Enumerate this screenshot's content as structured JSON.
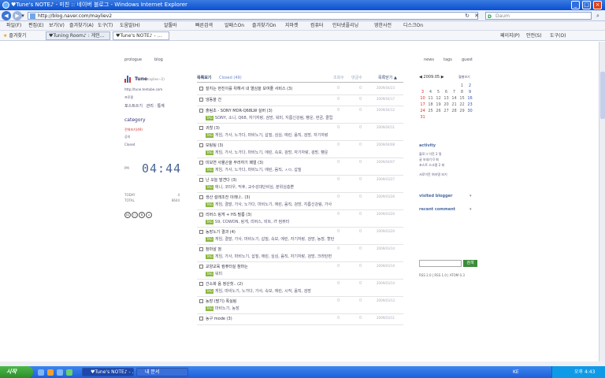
{
  "window": {
    "title": "♥Tune's NOTE♪ - 미친 :: 네이버 블로그 - Windows Internet Explorer",
    "min": "_",
    "max": "□",
    "close": "×"
  },
  "address": {
    "url": "http://blog.naver.com/mayliev2",
    "search_placeholder": "Daum"
  },
  "menu": [
    "파일(F)",
    "편집(E)",
    "보기(V)",
    "즐겨찾기(A)",
    "도구(T)",
    "도움말(H)"
  ],
  "toolbar_links": [
    "알툴바",
    "빠른검색",
    "알패스On",
    "즐겨찾기On",
    "지마켓",
    "컴퓨터",
    "인터넷플리닝",
    "영한사전",
    "디스크On"
  ],
  "favorites": {
    "label": "즐겨찾기",
    "tabs": [
      "♥Tuning Room♪ : 게인...",
      "♥Tune's NOTE♪ - ..."
    ],
    "tools": [
      "페이지(P)",
      "안전(S)",
      "도구(O)"
    ]
  },
  "blog": {
    "top_left": [
      "prologue",
      "blog"
    ],
    "top_right": [
      "news",
      "tags",
      "guest"
    ],
    "title": "Tune",
    "subtitle": "(mayliev∼2)",
    "url": "http://tune.tentube.com",
    "links": [
      "프로필",
      "포스트쓰기",
      "관리 · 통계"
    ],
    "category_title": "category",
    "categories": [
      "전체보기(49)",
      "공지",
      "Closed"
    ],
    "clock_ampm": "PM",
    "clock": "04:44",
    "stats": [
      {
        "label": "TODAY",
        "value": "4"
      },
      {
        "label": "TOTAL",
        "value": "8644"
      }
    ],
    "cc": [
      "cc",
      "$",
      "="
    ]
  },
  "list": {
    "title": "목록보기",
    "sub": "Closed (49)",
    "col_comments": "조회수",
    "col_views": "댓글수",
    "close": "목록닫기 ▲",
    "rows": [
      {
        "title": "잘지는 현진이를 위해서 내 열심을 보여줄 서비스 (3)",
        "c1": "0",
        "c2": "0",
        "date": "2009/04/23",
        "tags": ""
      },
      {
        "title": "냉동을 건",
        "c1": "0",
        "c2": "0",
        "date": "2009/04/17",
        "tags": ""
      },
      {
        "title": "출림초 - SONY MDR-Q68LW 실버 (3)",
        "c1": "0",
        "c2": "0",
        "date": "2009/04/12",
        "tags": "SONY, 소니, Q68, 자기자랑, 검망, 워미, 지름신강림, 빵운, 현금, 클럽"
      },
      {
        "title": "귀찮 (3)",
        "c1": "0",
        "c2": "0",
        "date": "2009/04/11",
        "tags": "게임, 가사, 노가다, 마비노기, 삽질, 심심, 에린, 움직, 검망, 자기자랑"
      },
      {
        "title": "보팅팅 (3)",
        "c1": "0",
        "c2": "0",
        "date": "2009/04/08",
        "tags": "게임, 가사, 노가다, 마비노기, 에린, 속보, 검망, 자기자랑, 검망, 빵운"
      },
      {
        "title": "미보연 사물곤을 부러하기 패럴 (3)",
        "c1": "0",
        "c2": "0",
        "date": "2009/04/07",
        "tags": "게임, 가사, 노가다, 마비노기, 에린, 움직, ㅅㅂ, 삽질"
      },
      {
        "title": "난 오늘 발견다 (3)",
        "c1": "0",
        "c2": "0",
        "date": "2009/03/27",
        "tags": "애니, 코타우, 믹후, 교수성대단비심, 분위심층쁜"
      },
      {
        "title": "생산 설래조전 이래나.. (3)",
        "c1": "0",
        "c2": "0",
        "date": "2009/03/26",
        "tags": "게임, 결말, 가사, 노가다, 마비노기, 에린, 움직, 검망, 지름신강림, 가사"
      },
      {
        "title": "리버스 링게 + HS 필름 (3)",
        "c1": "0",
        "c2": "0",
        "date": "2009/03/20",
        "tags": "S9, COWON, 링게, 리버스, 비트, IT 컴퓨터"
      },
      {
        "title": "농장노기 결과 (4)",
        "c1": "0",
        "c2": "0",
        "date": "2009/03/20",
        "tags": "게임, 결말, 가사, 마비노기, 삽질, 속보, 에린, 자기자랑, 검망, 농장, 할탄"
      },
      {
        "title": "참마살 껌",
        "c1": "0",
        "c2": "0",
        "date": "2009/03/14",
        "tags": "게임, 가사, 마비노기, 삽질, 에린, 심심, 움직, 자기자랑, 검망, 크라탄펀"
      },
      {
        "title": "교양교육 컴퓨터실 참마는",
        "c1": "0",
        "c2": "0",
        "date": "2009/03/14",
        "tags": "워미"
      },
      {
        "title": "간소화 음 정산첫.. (2)",
        "c1": "0",
        "c2": "0",
        "date": "2009/03/14",
        "tags": "게임, 마비노기, 노가다, 가사, 속보, 에린, 시작, 움직, 검망"
      },
      {
        "title": "농장 (팔기) 폭싫림",
        "c1": "0",
        "c2": "0",
        "date": "2009/03/13",
        "tags": "마비노기, 농장"
      },
      {
        "title": "농구 mode (3)",
        "c1": "0",
        "c2": "0",
        "date": "2009/03/11",
        "tags": ""
      }
    ]
  },
  "calendar": {
    "title": "◀ 2009.05 ▶",
    "right": "월별보기",
    "weeks": [
      [
        "",
        "",
        "",
        "",
        "",
        "1",
        "2"
      ],
      [
        "3",
        "4",
        "5",
        "6",
        "7",
        "8",
        "9"
      ],
      [
        "10",
        "11",
        "12",
        "13",
        "14",
        "15",
        "16"
      ],
      [
        "17",
        "18",
        "19",
        "20",
        "21",
        "22",
        "23"
      ],
      [
        "24",
        "25",
        "26",
        "27",
        "28",
        "29",
        "30"
      ],
      [
        "31",
        "",
        "",
        "",
        "",
        "",
        ""
      ]
    ]
  },
  "activity": {
    "title": "activity",
    "lines": [
      "블로그 이웃 2 명",
      "글 보내기 0 회",
      "포스트 스크랩 2 회",
      "서로이웃 여러명 보기"
    ]
  },
  "sections": [
    "visited blogger",
    "recent comment"
  ],
  "recent_button": "검색",
  "rss": "RSS 2.0 | RSS 1.0 | ATOM 0.3",
  "taskbar": {
    "start": "시작",
    "tasks": [
      "♥Tune's NOTE♪ - ...",
      "내 문서"
    ],
    "tray": "KE",
    "time": "오후 4:43"
  }
}
